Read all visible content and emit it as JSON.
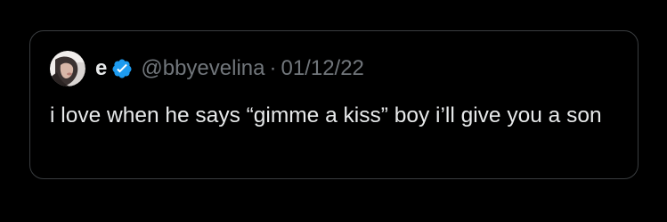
{
  "quote": {
    "display_name": "e",
    "verified_icon": "verified-badge-icon",
    "handle": "@bbyevelina",
    "separator": "·",
    "date": "01/12/22",
    "text": "i love when he says “gimme a kiss” boy i’ll give you a son"
  },
  "colors": {
    "background": "#000000",
    "border": "#3a3d40",
    "primary_text": "#e7e9ea",
    "secondary_text": "#71767b",
    "verified_blue": "#1d9bf0"
  }
}
